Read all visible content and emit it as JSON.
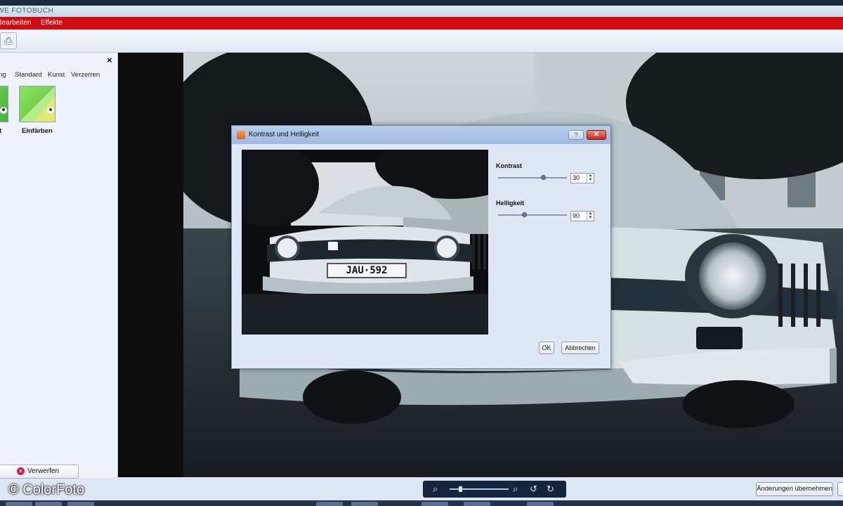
{
  "window": {
    "title": "WE FOTOBUCH"
  },
  "menu": [
    "Bearbeiten",
    "Effekte"
  ],
  "left_panel": {
    "close_glyph": "×",
    "tabs": [
      "ng",
      "Standard",
      "Kunst",
      "Verzerren"
    ],
    "effects": [
      {
        "label": "t"
      },
      {
        "label": "Einfärben"
      }
    ],
    "discard_button": "Verwerfen"
  },
  "dialog": {
    "title": "Kontrast und Helligkeit",
    "help_glyph": "?",
    "close_glyph": "✕",
    "contrast": {
      "label": "Kontrast",
      "value": "30",
      "slider_fraction": 0.65
    },
    "brightness": {
      "label": "Helligkeit",
      "value": "90",
      "slider_fraction": 0.38
    },
    "ok_button": "OK",
    "cancel_button": "Abbrechen",
    "plate_text": "JAU·592"
  },
  "bottom": {
    "zoom_out_glyph": "⌕",
    "zoom_in_glyph": "⌕",
    "rotate_left_glyph": "↺",
    "rotate_right_glyph": "↻",
    "zoom_fraction": 0.18,
    "apply_button": "Änderungen übernehmen"
  },
  "watermark": "© ColorFoto",
  "colors": {
    "menu_bar": "#d10b12",
    "zoom_bar": "#17243e",
    "dialog_title": "#b8cdea"
  }
}
